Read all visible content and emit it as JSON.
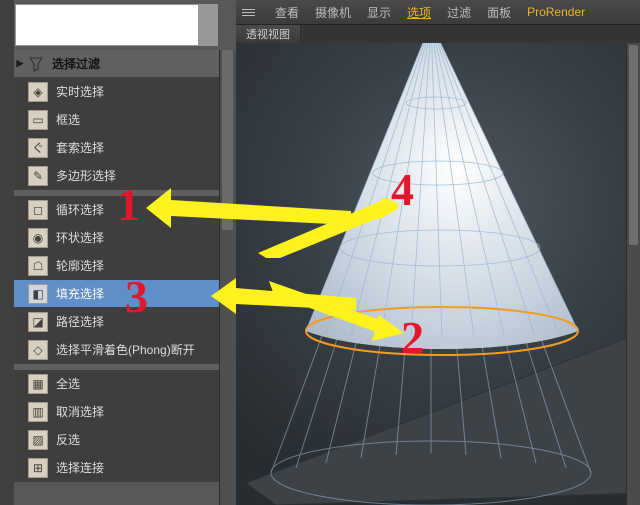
{
  "search": {
    "value": ""
  },
  "header1": {
    "label": "选择过滤"
  },
  "group1": [
    {
      "label": "实时选择",
      "icon": "◈"
    },
    {
      "label": "框选",
      "icon": "▭"
    },
    {
      "label": "套索选择",
      "icon": "ぐ"
    },
    {
      "label": "多边形选择",
      "icon": "✎"
    }
  ],
  "group2": [
    {
      "label": "循环选择",
      "icon": "◻"
    },
    {
      "label": "环状选择",
      "icon": "◉"
    },
    {
      "label": "轮廓选择",
      "icon": "☖"
    },
    {
      "label": "填充选择",
      "icon": "◧",
      "selected": true
    },
    {
      "label": "路径选择",
      "icon": "◪"
    },
    {
      "label": "选择平滑着色(Phong)断开",
      "icon": "◇"
    }
  ],
  "group3": [
    {
      "label": "全选",
      "icon": "▦"
    },
    {
      "label": "取消选择",
      "icon": "▥"
    },
    {
      "label": "反选",
      "icon": "▨"
    },
    {
      "label": "选择连接",
      "icon": "⊞"
    }
  ],
  "topbar": {
    "items": [
      "查看",
      "摄像机",
      "显示",
      "选项",
      "过滤",
      "面板",
      "ProRender"
    ],
    "highlight_index": 3
  },
  "viewport_tab": "透视视图",
  "annotations": {
    "n1": "1",
    "n2": "2",
    "n3": "3",
    "n4": "4"
  }
}
